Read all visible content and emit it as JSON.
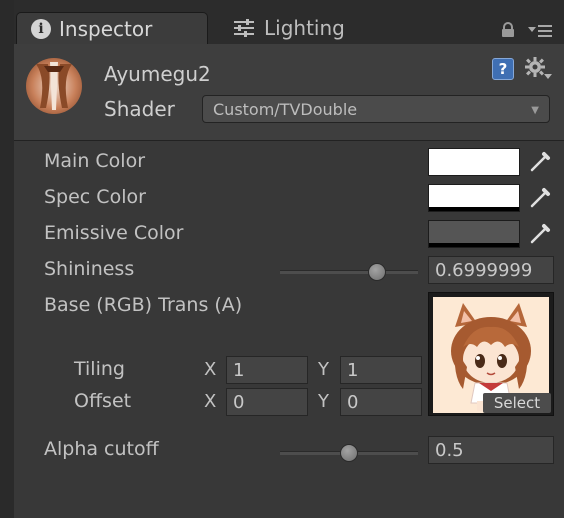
{
  "tabs": {
    "inspector_label": "Inspector",
    "lighting_label": "Lighting"
  },
  "material": {
    "name": "Ayumegu2",
    "shader_label": "Shader",
    "shader_value": "Custom/TVDouble"
  },
  "properties": {
    "main_color_label": "Main Color",
    "spec_color_label": "Spec Color",
    "emissive_color_label": "Emissive Color",
    "shininess_label": "Shininess",
    "shininess_value": "0.6999999",
    "shininess_fraction": 0.7,
    "base_label": "Base (RGB) Trans (A)",
    "tiling_label": "Tiling",
    "offset_label": "Offset",
    "tiling_x": "1",
    "tiling_y": "1",
    "offset_x": "0",
    "offset_y": "0",
    "axis_x": "X",
    "axis_y": "Y",
    "texture_select_label": "Select",
    "alpha_cutoff_label": "Alpha cutoff",
    "alpha_cutoff_value": "0.5",
    "alpha_cutoff_fraction": 0.5
  },
  "icons": {
    "info": "i",
    "help": "?",
    "shader_arrow": "▼"
  },
  "colors": {
    "main_color": "#ffffff",
    "spec_color": "#ffffff",
    "emissive_color": "#555555"
  }
}
